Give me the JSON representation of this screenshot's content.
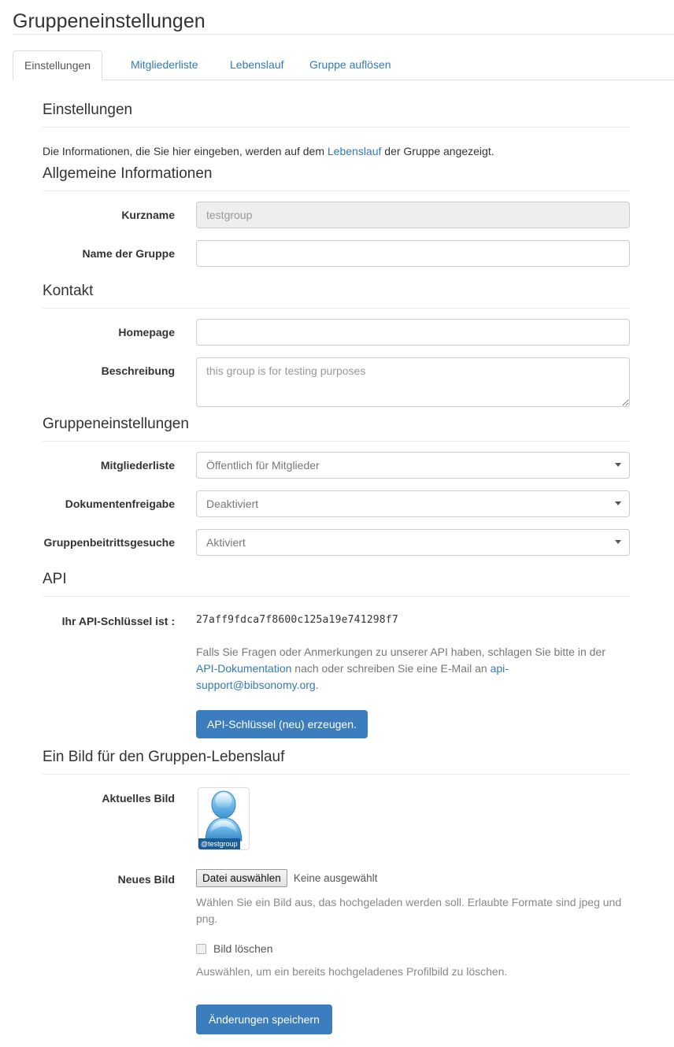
{
  "header": {
    "title": "Gruppeneinstellungen"
  },
  "tabs": [
    {
      "label": "Einstellungen",
      "active": true
    },
    {
      "label": "Mitgliederliste",
      "active": false
    },
    {
      "label": "Lebenslauf",
      "active": false
    },
    {
      "label": "Gruppe auflösen",
      "active": false
    }
  ],
  "settings_section": {
    "heading": "Einstellungen",
    "intro_before": "Die Informationen, die Sie hier eingeben, werden auf dem ",
    "intro_link": "Lebenslauf",
    "intro_after": " der Gruppe angezeigt."
  },
  "general_section": {
    "heading": "Allgemeine Informationen",
    "shortname_label": "Kurzname",
    "shortname_value": "testgroup",
    "groupname_label": "Name der Gruppe",
    "groupname_value": ""
  },
  "contact_section": {
    "heading": "Kontakt",
    "homepage_label": "Homepage",
    "homepage_value": "",
    "description_label": "Beschreibung",
    "description_value": "this group is for testing purposes"
  },
  "group_settings_section": {
    "heading": "Gruppeneinstellungen",
    "memberlist_label": "Mitgliederliste",
    "memberlist_value": "Öffentlich für Mitglieder",
    "docsharing_label": "Dokumentenfreigabe",
    "docsharing_value": "Deaktiviert",
    "joinrequests_label": "Gruppenbeitrittsgesuche",
    "joinrequests_value": "Aktiviert"
  },
  "api_section": {
    "heading": "API",
    "key_label": "Ihr API-Schlüssel ist :",
    "key_value": "27aff9fdca7f8600c125a19e741298f7",
    "text_before": "Falls Sie Fragen oder Anmerkungen zu unserer API haben, schlagen Sie bitte in der ",
    "doc_link": "API-Dokumentation",
    "text_middle": " nach oder schreiben Sie eine E-Mail an ",
    "email_link": "api-support@bibsonomy.org",
    "text_after": ".",
    "generate_button": "API-Schlüssel (neu) erzeugen."
  },
  "picture_section": {
    "heading": "Ein Bild für den Gruppen-Lebenslauf",
    "current_label": "Aktuelles Bild",
    "avatar_badge": "@testgroup",
    "new_label": "Neues Bild",
    "file_button": "Datei auswählen",
    "file_name": "Keine ausgewählt",
    "file_help": "Wählen Sie ein Bild aus, das hochgeladen werden soll. Erlaubte Formate sind jpeg und png.",
    "delete_checkbox_label": "Bild löschen",
    "delete_help": "Auswählen, um ein bereits hochgeladenes Profilbild zu löschen."
  },
  "footer": {
    "save_button": "Änderungen speichern"
  },
  "colors": {
    "link": "#337ab7",
    "primary_button": "#3b7dbd",
    "badge": "#1b5e96",
    "avatar_blue": "#63b0e8"
  }
}
